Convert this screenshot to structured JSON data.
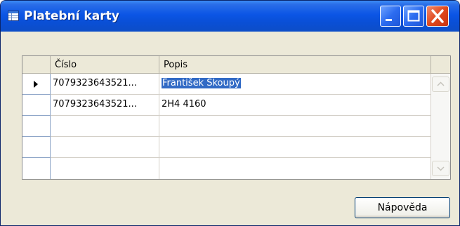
{
  "window": {
    "title": "Platební karty",
    "icon": "table-window-icon",
    "controls": [
      "minimize-icon",
      "maximize-icon",
      "close-icon"
    ],
    "accent_color": "#0b55e5"
  },
  "grid": {
    "columns": [
      "Číslo",
      "Popis"
    ],
    "rows": [
      {
        "current": true,
        "cislo": "7079323643521...",
        "popis": "František Skoupý",
        "popis_selected": true
      },
      {
        "current": false,
        "cislo": "7079323643521...",
        "popis": "2H4 4160",
        "popis_selected": false
      },
      {
        "current": false,
        "cislo": "",
        "popis": ""
      },
      {
        "current": false,
        "cislo": "",
        "popis": ""
      },
      {
        "current": false,
        "cislo": "",
        "popis": ""
      }
    ],
    "selection_color": "#316ac5"
  },
  "buttons": {
    "help_label": "Nápověda"
  }
}
